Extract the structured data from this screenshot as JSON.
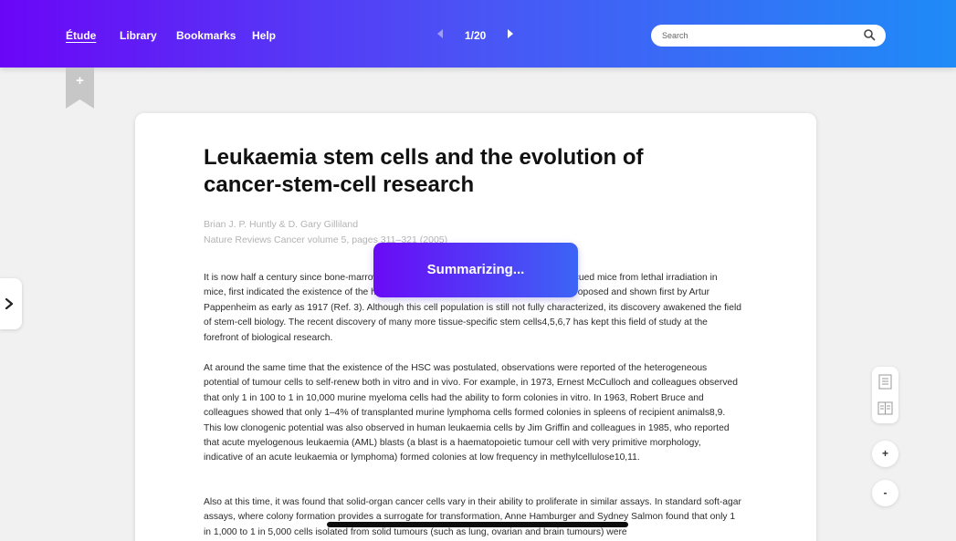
{
  "nav": {
    "links": [
      "Étude",
      "Library",
      "Bookmarks",
      "Help"
    ],
    "page_indicator": "1/20",
    "search_placeholder": "Search"
  },
  "bookmark": {
    "plus": "+"
  },
  "paper": {
    "title": "Leukaemia stem cells and the evolution of cancer-stem-cell research",
    "authors": "Brian J. P. Huntly & D. Gary Gilliland",
    "journal": "Nature Reviews Cancer volume 5, pages 311–321 (2005)",
    "paragraphs": [
      "It is now half a century since bone-marrow transplantation experiments, in which cells rescued mice from lethal irradiation in mice, first indicated the existence of the haematopoietic stem cell (HSC), a concept first proposed and shown first by Artur Pappenheim as early as 1917 (Ref. 3). Although this cell population is still not fully characterized, its discovery awakened the field of stem-cell biology. The recent discovery of many more tissue-specific stem cells4,5,6,7 has kept this field of study at the forefront of biological research.",
      "At around the same time that the existence of the HSC was postulated, observations were reported of the heterogeneous potential of tumour cells to self-renew both in vitro and in vivo. For example, in 1973, Ernest McCulloch and colleagues observed that only 1 in 100 to 1 in 10,000 murine myeloma cells had the ability to form colonies in vitro. In 1963, Robert Bruce and colleagues showed that only 1–4% of transplanted murine lymphoma cells formed colonies in spleens of recipient animals8,9. This low clonogenic potential was also observed in human leukaemia cells by Jim Griffin and colleagues in 1985, who reported that acute myelogenous leukaemia (AML) blasts (a blast is a haematopoietic tumour cell with very primitive morphology, indicative of an acute leukaemia or lymphoma) formed colonies at low frequency in methylcellulose10,11.",
      "Also at this time, it was found that solid-organ cancer cells vary in their ability to proliferate in similar assays. In standard soft-agar assays, where colony formation provides a surrogate for transformation, Anne Hamburger and Sydney Salmon found that only 1 in 1,000 to 1 in 5,000 cells isolated from solid tumours (such as lung, ovarian and brain tumours) were"
    ]
  },
  "summarize": {
    "label": "Summarizing..."
  },
  "zoom": {
    "in": "+",
    "out": "-"
  },
  "colors": {
    "accent_start": "#6a06f7",
    "accent_end": "#1f8bf7",
    "background": "#f1f1f1"
  }
}
